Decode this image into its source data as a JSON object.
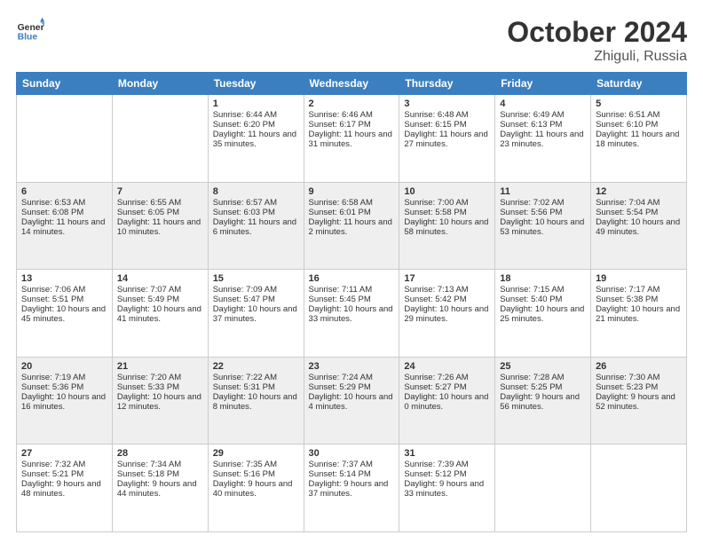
{
  "header": {
    "logo_line1": "General",
    "logo_line2": "Blue",
    "main_title": "October 2024",
    "subtitle": "Zhiguli, Russia"
  },
  "days": [
    "Sunday",
    "Monday",
    "Tuesday",
    "Wednesday",
    "Thursday",
    "Friday",
    "Saturday"
  ],
  "weeks": [
    [
      {
        "num": "",
        "sunrise": "",
        "sunset": "",
        "daylight": ""
      },
      {
        "num": "",
        "sunrise": "",
        "sunset": "",
        "daylight": ""
      },
      {
        "num": "1",
        "sunrise": "Sunrise: 6:44 AM",
        "sunset": "Sunset: 6:20 PM",
        "daylight": "Daylight: 11 hours and 35 minutes."
      },
      {
        "num": "2",
        "sunrise": "Sunrise: 6:46 AM",
        "sunset": "Sunset: 6:17 PM",
        "daylight": "Daylight: 11 hours and 31 minutes."
      },
      {
        "num": "3",
        "sunrise": "Sunrise: 6:48 AM",
        "sunset": "Sunset: 6:15 PM",
        "daylight": "Daylight: 11 hours and 27 minutes."
      },
      {
        "num": "4",
        "sunrise": "Sunrise: 6:49 AM",
        "sunset": "Sunset: 6:13 PM",
        "daylight": "Daylight: 11 hours and 23 minutes."
      },
      {
        "num": "5",
        "sunrise": "Sunrise: 6:51 AM",
        "sunset": "Sunset: 6:10 PM",
        "daylight": "Daylight: 11 hours and 18 minutes."
      }
    ],
    [
      {
        "num": "6",
        "sunrise": "Sunrise: 6:53 AM",
        "sunset": "Sunset: 6:08 PM",
        "daylight": "Daylight: 11 hours and 14 minutes."
      },
      {
        "num": "7",
        "sunrise": "Sunrise: 6:55 AM",
        "sunset": "Sunset: 6:05 PM",
        "daylight": "Daylight: 11 hours and 10 minutes."
      },
      {
        "num": "8",
        "sunrise": "Sunrise: 6:57 AM",
        "sunset": "Sunset: 6:03 PM",
        "daylight": "Daylight: 11 hours and 6 minutes."
      },
      {
        "num": "9",
        "sunrise": "Sunrise: 6:58 AM",
        "sunset": "Sunset: 6:01 PM",
        "daylight": "Daylight: 11 hours and 2 minutes."
      },
      {
        "num": "10",
        "sunrise": "Sunrise: 7:00 AM",
        "sunset": "Sunset: 5:58 PM",
        "daylight": "Daylight: 10 hours and 58 minutes."
      },
      {
        "num": "11",
        "sunrise": "Sunrise: 7:02 AM",
        "sunset": "Sunset: 5:56 PM",
        "daylight": "Daylight: 10 hours and 53 minutes."
      },
      {
        "num": "12",
        "sunrise": "Sunrise: 7:04 AM",
        "sunset": "Sunset: 5:54 PM",
        "daylight": "Daylight: 10 hours and 49 minutes."
      }
    ],
    [
      {
        "num": "13",
        "sunrise": "Sunrise: 7:06 AM",
        "sunset": "Sunset: 5:51 PM",
        "daylight": "Daylight: 10 hours and 45 minutes."
      },
      {
        "num": "14",
        "sunrise": "Sunrise: 7:07 AM",
        "sunset": "Sunset: 5:49 PM",
        "daylight": "Daylight: 10 hours and 41 minutes."
      },
      {
        "num": "15",
        "sunrise": "Sunrise: 7:09 AM",
        "sunset": "Sunset: 5:47 PM",
        "daylight": "Daylight: 10 hours and 37 minutes."
      },
      {
        "num": "16",
        "sunrise": "Sunrise: 7:11 AM",
        "sunset": "Sunset: 5:45 PM",
        "daylight": "Daylight: 10 hours and 33 minutes."
      },
      {
        "num": "17",
        "sunrise": "Sunrise: 7:13 AM",
        "sunset": "Sunset: 5:42 PM",
        "daylight": "Daylight: 10 hours and 29 minutes."
      },
      {
        "num": "18",
        "sunrise": "Sunrise: 7:15 AM",
        "sunset": "Sunset: 5:40 PM",
        "daylight": "Daylight: 10 hours and 25 minutes."
      },
      {
        "num": "19",
        "sunrise": "Sunrise: 7:17 AM",
        "sunset": "Sunset: 5:38 PM",
        "daylight": "Daylight: 10 hours and 21 minutes."
      }
    ],
    [
      {
        "num": "20",
        "sunrise": "Sunrise: 7:19 AM",
        "sunset": "Sunset: 5:36 PM",
        "daylight": "Daylight: 10 hours and 16 minutes."
      },
      {
        "num": "21",
        "sunrise": "Sunrise: 7:20 AM",
        "sunset": "Sunset: 5:33 PM",
        "daylight": "Daylight: 10 hours and 12 minutes."
      },
      {
        "num": "22",
        "sunrise": "Sunrise: 7:22 AM",
        "sunset": "Sunset: 5:31 PM",
        "daylight": "Daylight: 10 hours and 8 minutes."
      },
      {
        "num": "23",
        "sunrise": "Sunrise: 7:24 AM",
        "sunset": "Sunset: 5:29 PM",
        "daylight": "Daylight: 10 hours and 4 minutes."
      },
      {
        "num": "24",
        "sunrise": "Sunrise: 7:26 AM",
        "sunset": "Sunset: 5:27 PM",
        "daylight": "Daylight: 10 hours and 0 minutes."
      },
      {
        "num": "25",
        "sunrise": "Sunrise: 7:28 AM",
        "sunset": "Sunset: 5:25 PM",
        "daylight": "Daylight: 9 hours and 56 minutes."
      },
      {
        "num": "26",
        "sunrise": "Sunrise: 7:30 AM",
        "sunset": "Sunset: 5:23 PM",
        "daylight": "Daylight: 9 hours and 52 minutes."
      }
    ],
    [
      {
        "num": "27",
        "sunrise": "Sunrise: 7:32 AM",
        "sunset": "Sunset: 5:21 PM",
        "daylight": "Daylight: 9 hours and 48 minutes."
      },
      {
        "num": "28",
        "sunrise": "Sunrise: 7:34 AM",
        "sunset": "Sunset: 5:18 PM",
        "daylight": "Daylight: 9 hours and 44 minutes."
      },
      {
        "num": "29",
        "sunrise": "Sunrise: 7:35 AM",
        "sunset": "Sunset: 5:16 PM",
        "daylight": "Daylight: 9 hours and 40 minutes."
      },
      {
        "num": "30",
        "sunrise": "Sunrise: 7:37 AM",
        "sunset": "Sunset: 5:14 PM",
        "daylight": "Daylight: 9 hours and 37 minutes."
      },
      {
        "num": "31",
        "sunrise": "Sunrise: 7:39 AM",
        "sunset": "Sunset: 5:12 PM",
        "daylight": "Daylight: 9 hours and 33 minutes."
      },
      {
        "num": "",
        "sunrise": "",
        "sunset": "",
        "daylight": ""
      },
      {
        "num": "",
        "sunrise": "",
        "sunset": "",
        "daylight": ""
      }
    ]
  ]
}
